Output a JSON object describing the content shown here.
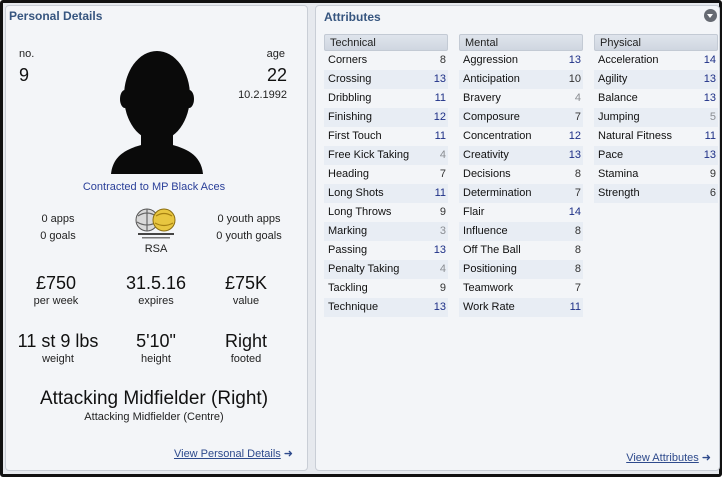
{
  "personal": {
    "title": "Personal Details",
    "no_label": "no.",
    "no_value": "9",
    "age_label": "age",
    "age_value": "22",
    "dob": "10.2.1992",
    "contract": "Contracted to MP Black Aces",
    "apps": "0 apps",
    "goals": "0 goals",
    "youth_apps": "0 youth apps",
    "youth_goals": "0 youth goals",
    "nation": "RSA",
    "wage": "£750",
    "wage_label": "per week",
    "expires": "31.5.16",
    "expires_label": "expires",
    "value": "£75K",
    "value_label": "value",
    "weight": "11 st 9 lbs",
    "weight_label": "weight",
    "height": "5'10\"",
    "height_label": "height",
    "foot": "Right",
    "foot_label": "footed",
    "position": "Attacking Midfielder (Right)",
    "position_alt": "Attacking Midfielder (Centre)",
    "view_link": "View Personal Details",
    "icons": {
      "portrait": "player-silhouette-icon",
      "federation": "federation-logo-icon",
      "arrow": "arrow-right-icon"
    }
  },
  "attributes": {
    "title": "Attributes",
    "view_link": "View Attributes",
    "colors": {
      "low": "#8a8d92",
      "mid": "#333333",
      "high": "#1d2f86",
      "title": "#36557f"
    },
    "columns": [
      {
        "header": "Technical",
        "items": [
          {
            "name": "Corners",
            "value": "8"
          },
          {
            "name": "Crossing",
            "value": "13"
          },
          {
            "name": "Dribbling",
            "value": "11"
          },
          {
            "name": "Finishing",
            "value": "12"
          },
          {
            "name": "First Touch",
            "value": "11"
          },
          {
            "name": "Free Kick Taking",
            "value": "4"
          },
          {
            "name": "Heading",
            "value": "7"
          },
          {
            "name": "Long Shots",
            "value": "11"
          },
          {
            "name": "Long Throws",
            "value": "9"
          },
          {
            "name": "Marking",
            "value": "3"
          },
          {
            "name": "Passing",
            "value": "13"
          },
          {
            "name": "Penalty Taking",
            "value": "4"
          },
          {
            "name": "Tackling",
            "value": "9"
          },
          {
            "name": "Technique",
            "value": "13"
          }
        ]
      },
      {
        "header": "Mental",
        "items": [
          {
            "name": "Aggression",
            "value": "13"
          },
          {
            "name": "Anticipation",
            "value": "10"
          },
          {
            "name": "Bravery",
            "value": "4"
          },
          {
            "name": "Composure",
            "value": "7"
          },
          {
            "name": "Concentration",
            "value": "12"
          },
          {
            "name": "Creativity",
            "value": "13"
          },
          {
            "name": "Decisions",
            "value": "8"
          },
          {
            "name": "Determination",
            "value": "7"
          },
          {
            "name": "Flair",
            "value": "14"
          },
          {
            "name": "Influence",
            "value": "8"
          },
          {
            "name": "Off The Ball",
            "value": "8"
          },
          {
            "name": "Positioning",
            "value": "8"
          },
          {
            "name": "Teamwork",
            "value": "7"
          },
          {
            "name": "Work Rate",
            "value": "11"
          }
        ]
      },
      {
        "header": "Physical",
        "items": [
          {
            "name": "Acceleration",
            "value": "14"
          },
          {
            "name": "Agility",
            "value": "13"
          },
          {
            "name": "Balance",
            "value": "13"
          },
          {
            "name": "Jumping",
            "value": "5"
          },
          {
            "name": "Natural Fitness",
            "value": "11"
          },
          {
            "name": "Pace",
            "value": "13"
          },
          {
            "name": "Stamina",
            "value": "9"
          },
          {
            "name": "Strength",
            "value": "6"
          }
        ]
      }
    ]
  }
}
